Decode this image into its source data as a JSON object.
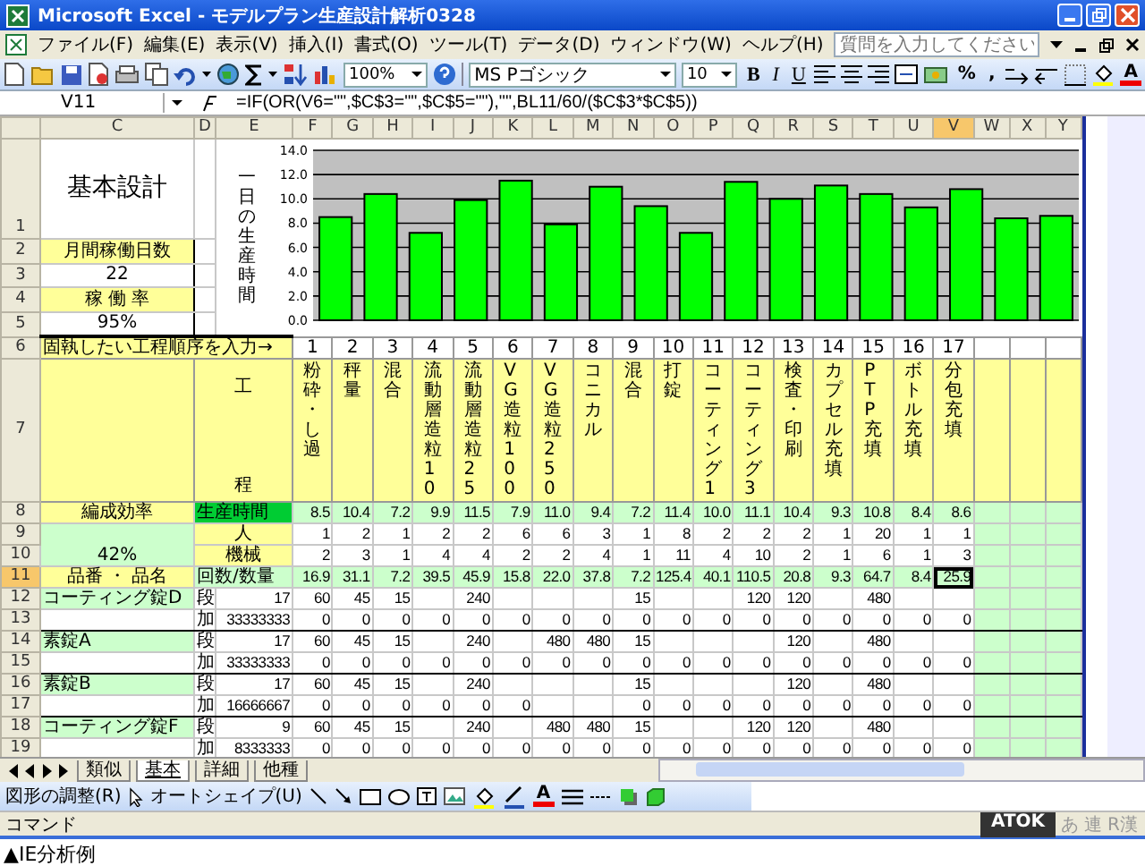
{
  "window": {
    "title": "Microsoft Excel - モデルプラン生産設計解析0328"
  },
  "menu": [
    "ファイル(F)",
    "編集(E)",
    "表示(V)",
    "挿入(I)",
    "書式(O)",
    "ツール(T)",
    "データ(D)",
    "ウィンドウ(W)",
    "ヘルプ(H)"
  ],
  "help_field": {
    "placeholder": "質問を入力してください"
  },
  "toolbar": {
    "zoom": "100%",
    "font": "MS Pゴシック",
    "size": "10",
    "bold": "B",
    "italic": "I",
    "underline": "U",
    "percent": "%",
    "comma": ",",
    "font_color": "A"
  },
  "formula_bar": {
    "name_box": "V11",
    "formula": "=IF(OR(V6=\"\",$C$3=\"\",$C$5=\"\"),\"\",BL11/60/($C$3*$C$5))"
  },
  "columns": [
    {
      "label": "C",
      "selected": false
    },
    {
      "label": "D",
      "selected": false
    },
    {
      "label": "E",
      "selected": false
    },
    {
      "label": "F",
      "selected": false
    },
    {
      "label": "G",
      "selected": false
    },
    {
      "label": "H",
      "selected": false
    },
    {
      "label": "I",
      "selected": false
    },
    {
      "label": "J",
      "selected": false
    },
    {
      "label": "K",
      "selected": false
    },
    {
      "label": "L",
      "selected": false
    },
    {
      "label": "M",
      "selected": false
    },
    {
      "label": "N",
      "selected": false
    },
    {
      "label": "O",
      "selected": false
    },
    {
      "label": "P",
      "selected": false
    },
    {
      "label": "Q",
      "selected": false
    },
    {
      "label": "R",
      "selected": false
    },
    {
      "label": "S",
      "selected": false
    },
    {
      "label": "T",
      "selected": false
    },
    {
      "label": "U",
      "selected": false
    },
    {
      "label": "V",
      "selected": true
    },
    {
      "label": "W",
      "selected": false
    },
    {
      "label": "X",
      "selected": false
    },
    {
      "label": "Y",
      "selected": false
    }
  ],
  "top_rows": [
    {
      "number": "1",
      "kind": "title",
      "text": "基本設計"
    },
    {
      "number": "2",
      "kind": "label",
      "text": "月間稼働日数"
    },
    {
      "number": "3",
      "kind": "value",
      "text": "22"
    },
    {
      "number": "4",
      "kind": "label",
      "text": "稼 働 率"
    },
    {
      "number": "5",
      "kind": "value",
      "text": "95%"
    }
  ],
  "chart": {
    "chart_data": {
      "type": "bar",
      "ylabel": "一日の生産時間",
      "grid": true,
      "values": [
        8.5,
        10.4,
        7.2,
        9.9,
        11.5,
        7.9,
        11.0,
        9.4,
        7.2,
        11.4,
        10.0,
        11.1,
        10.4,
        9.3,
        10.8,
        8.4,
        8.6
      ],
      "ylim": [
        0,
        14
      ],
      "yticks": [
        {
          "value": 0,
          "label": "0.0"
        },
        {
          "value": 2,
          "label": "2.0"
        },
        {
          "value": 4,
          "label": "4.0"
        },
        {
          "value": 6,
          "label": "6.0"
        },
        {
          "value": 8,
          "label": "8.0"
        },
        {
          "value": 10,
          "label": "10.0"
        },
        {
          "value": 12,
          "label": "12.0"
        },
        {
          "value": 14,
          "label": "14.0"
        }
      ]
    }
  },
  "order_row": {
    "number": "6",
    "label": "固執したい工程順序を入力→",
    "steps": [
      "1",
      "2",
      "3",
      "4",
      "5",
      "6",
      "7",
      "8",
      "9",
      "10",
      "11",
      "12",
      "13",
      "14",
      "15",
      "16",
      "17"
    ]
  },
  "process_row": {
    "number": "7",
    "label_top": "工",
    "label_bottom": "程",
    "processes": [
      "粉砕・し過",
      "秤量",
      "混合",
      "流動層造粒10",
      "流動層造粒25",
      "VG造粒100",
      "VG造粒250",
      "コニカル",
      "混合",
      "打錠",
      "コーティング1",
      "コーティング3",
      "検査・印刷",
      "カプセル充填",
      "PTP充填",
      "ボトル充填",
      "分包充填"
    ]
  },
  "summary_rows": [
    {
      "number": "8",
      "selected": false,
      "c_cell": {
        "kind": "label",
        "text": "編成効率"
      },
      "kind": "time",
      "label": "生産時間",
      "values": [
        "8.5",
        "10.4",
        "7.2",
        "9.9",
        "11.5",
        "7.9",
        "11.0",
        "9.4",
        "7.2",
        "11.4",
        "10.0",
        "11.1",
        "10.4",
        "9.3",
        "10.8",
        "8.4",
        "8.6"
      ]
    },
    {
      "number": "9",
      "selected": false,
      "c_cell": {
        "kind": "tall_value",
        "text": "42%"
      },
      "kind": "count",
      "label": "人",
      "values": [
        "1",
        "2",
        "1",
        "2",
        "2",
        "6",
        "6",
        "3",
        "1",
        "8",
        "2",
        "2",
        "2",
        "1",
        "20",
        "1",
        "1"
      ]
    },
    {
      "number": "10",
      "selected": false,
      "kind": "count",
      "label": "機械",
      "values": [
        "2",
        "3",
        "1",
        "4",
        "4",
        "2",
        "2",
        "4",
        "1",
        "11",
        "4",
        "10",
        "2",
        "1",
        "6",
        "1",
        "3"
      ]
    },
    {
      "number": "11",
      "selected": true,
      "c_cell": {
        "kind": "label",
        "text": "品番 ・ 品名"
      },
      "kind": "qty",
      "label": "回数/数量",
      "values": [
        "16.9",
        "31.1",
        "7.2",
        "39.5",
        "45.9",
        "15.8",
        "22.0",
        "37.8",
        "7.2",
        "125.4",
        "40.1",
        "110.5",
        "20.8",
        "9.3",
        "64.7",
        "8.4",
        "25.9"
      ]
    }
  ],
  "products": [
    {
      "name": "コーティング錠D",
      "rows": [
        {
          "number": "12",
          "label": "段",
          "quantity": "17",
          "cells": [
            {
              "text": "60"
            },
            {
              "text": "45"
            },
            {
              "text": "15"
            },
            {},
            {
              "text": "240"
            },
            {},
            {},
            {},
            {
              "text": "15"
            },
            {},
            {},
            {
              "text": "120"
            },
            {
              "text": "120"
            },
            {},
            {
              "text": "480"
            },
            {},
            {}
          ]
        },
        {
          "number": "13",
          "label": "加",
          "quantity": "33333333",
          "cells": [
            {
              "text": "0"
            },
            {
              "text": "0"
            },
            {
              "text": "0"
            },
            {
              "text": "0"
            },
            {
              "text": "0"
            },
            {
              "text": "0"
            },
            {
              "text": "0"
            },
            {
              "text": "0"
            },
            {
              "text": "0"
            },
            {
              "text": "0"
            },
            {
              "text": "0"
            },
            {
              "text": "0"
            },
            {
              "text": "0"
            },
            {
              "text": "0"
            },
            {
              "text": "0"
            },
            {
              "text": "0"
            },
            {
              "text": "0"
            }
          ]
        }
      ]
    },
    {
      "name": "素錠A",
      "rows": [
        {
          "number": "14",
          "label": "段",
          "quantity": "17",
          "cells": [
            {
              "text": "60"
            },
            {
              "text": "45"
            },
            {
              "text": "15"
            },
            {},
            {
              "text": "240"
            },
            {},
            {
              "text": "480"
            },
            {
              "text": "480"
            },
            {
              "text": "15"
            },
            {},
            {},
            {},
            {
              "text": "120"
            },
            {},
            {
              "text": "480"
            },
            {},
            {}
          ]
        },
        {
          "number": "15",
          "label": "加",
          "quantity": "33333333",
          "cells": [
            {
              "text": "0"
            },
            {
              "text": "0"
            },
            {
              "text": "0"
            },
            {
              "text": "0"
            },
            {
              "text": "0"
            },
            {
              "text": "0"
            },
            {
              "text": "0"
            },
            {
              "text": "0"
            },
            {
              "text": "0"
            },
            {
              "text": "0"
            },
            {
              "text": "0"
            },
            {
              "text": "0"
            },
            {
              "text": "0"
            },
            {
              "text": "0"
            },
            {
              "text": "0"
            },
            {
              "text": "0"
            },
            {
              "text": "0"
            }
          ]
        }
      ]
    },
    {
      "name": "素錠B",
      "rows": [
        {
          "number": "16",
          "label": "段",
          "quantity": "17",
          "cells": [
            {
              "text": "60"
            },
            {
              "text": "45"
            },
            {
              "text": "15"
            },
            {},
            {
              "text": "240"
            },
            {},
            {},
            {},
            {
              "text": "15"
            },
            {},
            {},
            {},
            {
              "text": "120"
            },
            {},
            {
              "text": "480"
            },
            {},
            {}
          ]
        },
        {
          "number": "17",
          "label": "加",
          "quantity": "16666667",
          "cells": [
            {
              "text": "0"
            },
            {
              "text": "0"
            },
            {
              "text": "0"
            },
            {
              "text": "0"
            },
            {
              "text": "0"
            },
            {
              "text": "0"
            },
            {},
            {},
            {
              "text": "0"
            },
            {
              "text": "0"
            },
            {
              "text": "0"
            },
            {
              "text": "0"
            },
            {
              "text": "0"
            },
            {
              "text": "0"
            },
            {
              "text": "0"
            },
            {
              "text": "0"
            },
            {
              "text": "0"
            }
          ]
        }
      ]
    },
    {
      "name": "コーティング錠F",
      "rows": [
        {
          "number": "18",
          "label": "段",
          "quantity": "9",
          "cells": [
            {
              "text": "60"
            },
            {
              "text": "45"
            },
            {
              "text": "15"
            },
            {},
            {
              "text": "240"
            },
            {},
            {
              "text": "480"
            },
            {
              "text": "480"
            },
            {
              "text": "15"
            },
            {},
            {},
            {
              "text": "120"
            },
            {
              "text": "120"
            },
            {},
            {
              "text": "480"
            },
            {},
            {}
          ]
        },
        {
          "number": "19",
          "label": "加",
          "quantity": "8333333",
          "cells": [
            {
              "text": "0"
            },
            {
              "text": "0"
            },
            {
              "text": "0"
            },
            {
              "text": "0"
            },
            {
              "text": "0"
            },
            {
              "text": "0"
            },
            {
              "text": "0"
            },
            {
              "text": "0"
            },
            {
              "text": "0"
            },
            {
              "text": "0"
            },
            {
              "text": "0"
            },
            {
              "text": "0"
            },
            {
              "text": "0"
            },
            {
              "text": "0"
            },
            {
              "text": "0"
            },
            {
              "text": "0"
            },
            {
              "text": "0"
            }
          ]
        }
      ]
    }
  ],
  "sheet_tabs": [
    {
      "label": "類似",
      "selected": false
    },
    {
      "label": "基本",
      "selected": true
    },
    {
      "label": "詳細",
      "selected": false
    },
    {
      "label": "他種",
      "selected": false
    }
  ],
  "drawing_toolbar": {
    "adjust": "図形の調整(R)",
    "autoshape": "オートシェイプ(U)",
    "font_color": "A"
  },
  "status_bar": {
    "text": "コマンド",
    "ime": [
      {
        "label": "ATOK",
        "selected": true
      },
      {
        "label": "あ",
        "selected": false
      },
      {
        "label": "連",
        "selected": false
      },
      {
        "label": "R漢",
        "selected": false
      }
    ]
  },
  "caption": "▲IE分析例"
}
